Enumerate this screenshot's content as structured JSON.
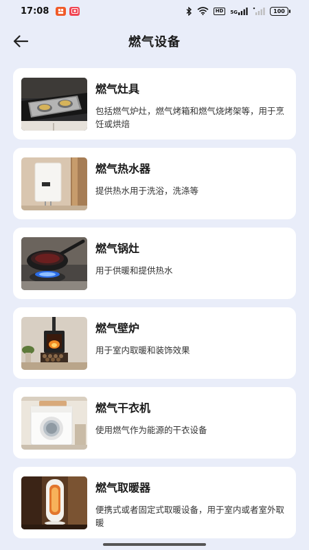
{
  "status_bar": {
    "time": "17:08",
    "hd_label": "HD",
    "network_label": "5G",
    "battery": "100",
    "colors": {
      "app1": "#f05a28",
      "app2": "#f04452"
    }
  },
  "header": {
    "back_icon": "arrow-left-icon",
    "title": "燃气设备"
  },
  "devices": [
    {
      "title": "燃气灶具",
      "desc": "包括燃气炉灶，燃气烤箱和燃气烧烤架等，用于烹饪或烘焙",
      "image": "gas-stove-image"
    },
    {
      "title": "燃气热水器",
      "desc": "提供热水用于洗浴，洗涤等",
      "image": "gas-water-heater-image"
    },
    {
      "title": "燃气锅灶",
      "desc": "用于供暖和提供热水",
      "image": "gas-wok-burner-image"
    },
    {
      "title": "燃气壁炉",
      "desc": "用于室内取暖和装饰效果",
      "image": "gas-fireplace-image"
    },
    {
      "title": "燃气干衣机",
      "desc": "使用燃气作为能源的干衣设备",
      "image": "gas-dryer-image"
    },
    {
      "title": "燃气取暖器",
      "desc": "便携式或者固定式取暖设备，用于室内或者室外取暖",
      "image": "gas-heater-image"
    }
  ]
}
